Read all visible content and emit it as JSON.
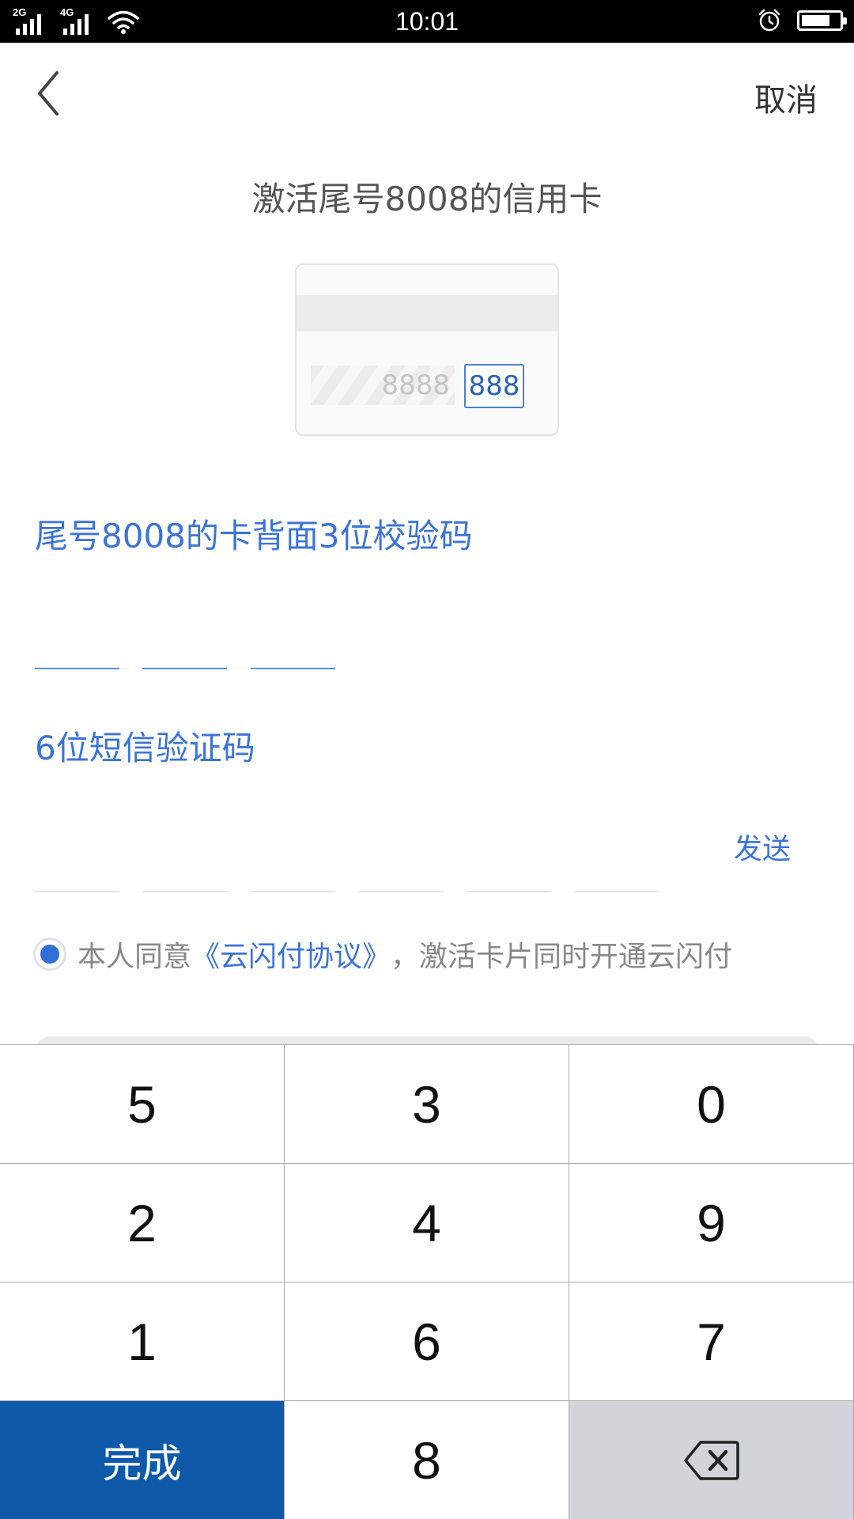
{
  "status_bar": {
    "time": "10:01",
    "network_1": "2G",
    "network_2": "4G",
    "battery_level": 0.75
  },
  "nav": {
    "cancel_label": "取消"
  },
  "title": "激活尾号8008的信用卡",
  "card_illustration": {
    "signature_digits": "8888",
    "cvv_digits": "888"
  },
  "cvv_section": {
    "label": "尾号8008的卡背面3位校验码",
    "digit_count": 3
  },
  "sms_section": {
    "label": "6位短信验证码",
    "send_label": "发送",
    "digit_count": 6
  },
  "agreement": {
    "checked": true,
    "prefix": "本人同意",
    "link": "《云闪付协议》",
    "suffix": "，激活卡片同时开通云闪付"
  },
  "keypad": {
    "keys": [
      "5",
      "3",
      "0",
      "2",
      "4",
      "9",
      "1",
      "6",
      "7"
    ],
    "done_label": "完成",
    "last_row_digit": "8",
    "delete_icon": "backspace-icon"
  }
}
